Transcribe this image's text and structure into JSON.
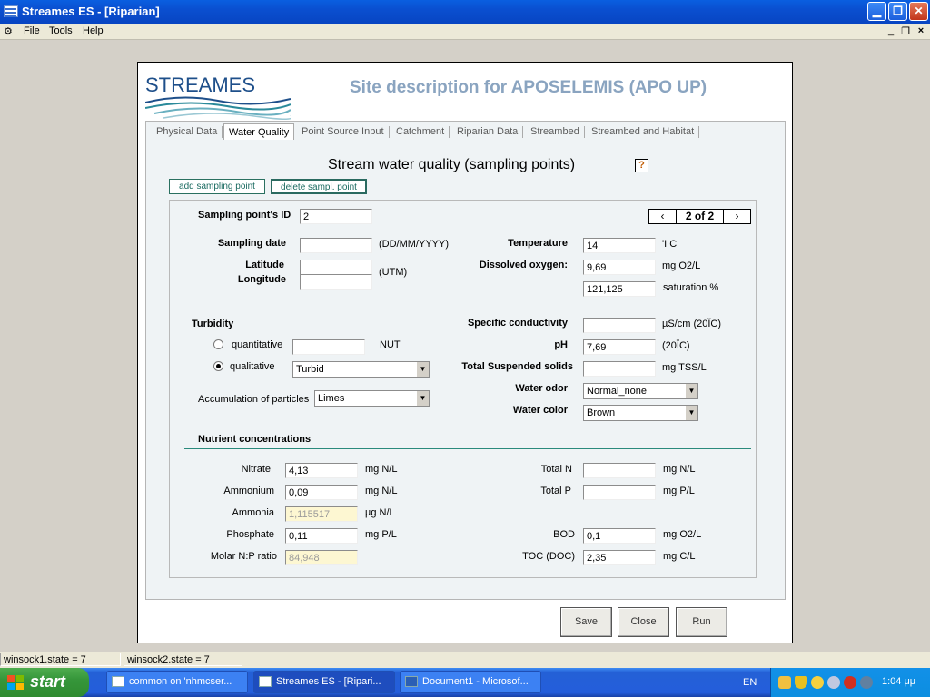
{
  "window": {
    "title": "Streames ES - [Riparian]"
  },
  "menu": [
    "File",
    "Tools",
    "Help"
  ],
  "header": {
    "logo_text": "STREAMES",
    "title": "Site description for APOSELEMIS (APO UP)"
  },
  "tabs": [
    "Physical Data",
    "Water Quality",
    "Point Source Input",
    "Catchment",
    "Riparian Data",
    "Streambed",
    "Streambed and Habitat"
  ],
  "active_tab": "Water Quality",
  "section": {
    "title": "Stream water quality (sampling points)",
    "help": "?",
    "add_btn": "add sampling point",
    "delete_btn": "delete sampl. point"
  },
  "nav": {
    "prev": "‹",
    "next": "›",
    "counter": "2 of 2"
  },
  "form": {
    "sampling_id": {
      "label": "Sampling point's ID",
      "value": "2"
    },
    "sampling_date": {
      "label": "Sampling date",
      "value": "",
      "unit": "(DD/MM/YYYY)"
    },
    "latitude": {
      "label": "Latitude",
      "value": ""
    },
    "longitude": {
      "label": "Longitude",
      "value": "",
      "unit": "(UTM)"
    },
    "temperature": {
      "label": "Temperature",
      "value": "14",
      "unit": "'I C"
    },
    "dissolved_oxygen": {
      "label": "Dissolved oxygen:",
      "value": "9,69",
      "unit": "mg O2/L"
    },
    "saturation": {
      "value": "121,125",
      "unit": "saturation %"
    },
    "turbidity": {
      "label": "Turbidity",
      "quantitative_label": "quantitative",
      "quantitative_value": "",
      "quantitative_unit": "NUT",
      "qualitative_label": "qualitative",
      "qualitative_value": "Turbid",
      "selected": "qualitative"
    },
    "accumulation": {
      "label": "Accumulation of particles",
      "value": "Limes"
    },
    "specific_conductivity": {
      "label": "Specific conductivity",
      "value": "",
      "unit": "µS/cm (20ÏC)"
    },
    "ph": {
      "label": "pH",
      "value": "7,69",
      "unit": "(20ÏC)"
    },
    "tss": {
      "label": "Total Suspended solids",
      "value": "",
      "unit": "mg TSS/L"
    },
    "water_odor": {
      "label": "Water odor",
      "value": "Normal_none"
    },
    "water_color": {
      "label": "Water color",
      "value": "Brown"
    },
    "nutrient_title": "Nutrient concentrations",
    "nitrate": {
      "label": "Nitrate",
      "value": "4,13",
      "unit": "mg N/L"
    },
    "ammonium": {
      "label": "Ammonium",
      "value": "0,09",
      "unit": "mg N/L"
    },
    "ammonia": {
      "label": "Ammonia",
      "value": "1,115517",
      "unit": "µg N/L"
    },
    "phosphate": {
      "label": "Phosphate",
      "value": "0,11",
      "unit": "mg P/L"
    },
    "molar_np": {
      "label": "Molar N:P ratio",
      "value": "84,948"
    },
    "total_n": {
      "label": "Total N",
      "value": "",
      "unit": "mg N/L"
    },
    "total_p": {
      "label": "Total P",
      "value": "",
      "unit": "mg P/L"
    },
    "bod": {
      "label": "BOD",
      "value": "0,1",
      "unit": "mg O2/L"
    },
    "toc": {
      "label": "TOC (DOC)",
      "value": "2,35",
      "unit": "mg C/L"
    }
  },
  "buttons": {
    "save": "Save",
    "close": "Close",
    "run": "Run"
  },
  "status": {
    "pane1": "winsock1.state =   7",
    "pane2": "winsock2.state =   7"
  },
  "taskbar": {
    "start": "start",
    "tasks": [
      "common on 'nhmcser...",
      "Streames ES - [Ripari...",
      "Document1 - Microsof..."
    ],
    "lang": "EN",
    "clock": "1:04 μμ"
  },
  "colors": {
    "title_blue": "#0a55d8",
    "header_title": "#8aa4c0",
    "accent_line": "#2a8a7c",
    "panel_bg": "#eff3f5",
    "disabled_field": "#fdf7d2"
  }
}
